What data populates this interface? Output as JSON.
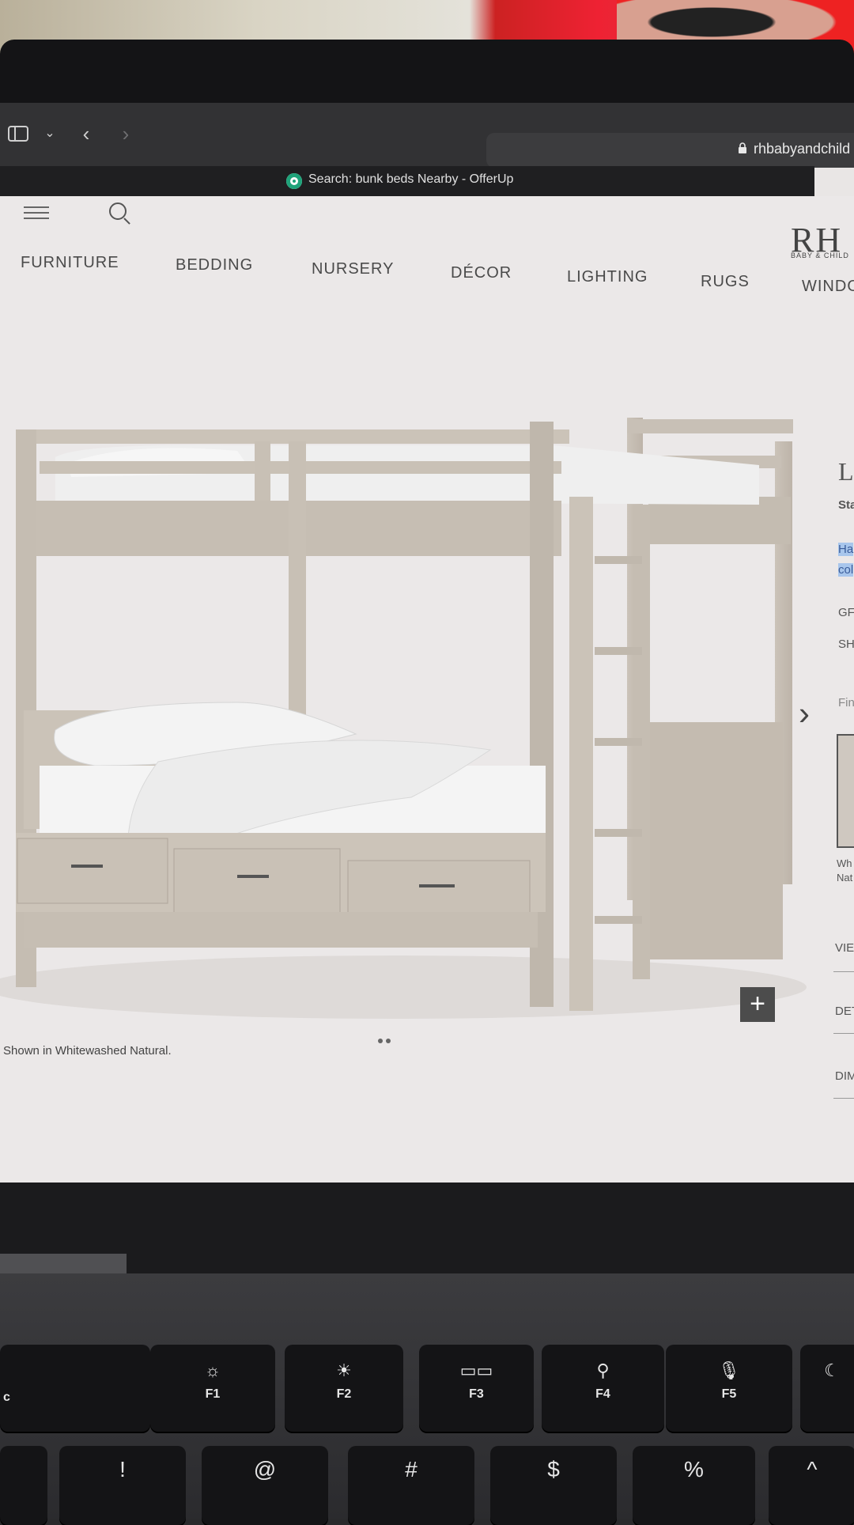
{
  "browser": {
    "url": "rhbabyandchild",
    "tab_title": "Search: bunk beds Nearby - OfferUp"
  },
  "site": {
    "logo": "RH",
    "logo_sub": "BABY & CHILD",
    "nav": [
      "FURNITURE",
      "BEDDING",
      "NURSERY",
      "DÉCOR",
      "LIGHTING",
      "RUGS",
      "WINDO"
    ]
  },
  "product": {
    "caption": "Shown in Whitewashed Natural.",
    "title_fragment": "L",
    "sub_fragment": "Sta",
    "highlight_fragment_1": "Ha",
    "highlight_fragment_2": "col",
    "gr_label": "GF",
    "sh_label": "SH",
    "finish_label": "Fin",
    "swatch_name_1": "Wh",
    "swatch_name_2": "Nat",
    "view_label": "VIE",
    "details_label": "DET",
    "dimensions_label": "DIM",
    "plus_label": "+",
    "next_label": "›"
  },
  "keyboard": {
    "fn_keys": [
      {
        "icon": "☼",
        "label": "F1"
      },
      {
        "icon": "☀",
        "label": "F2"
      },
      {
        "icon": "▭▭",
        "label": "F3"
      },
      {
        "icon": "⚲",
        "label": "F4"
      },
      {
        "icon": "🎙",
        "label": "F5"
      }
    ],
    "number_keys": [
      "!",
      "@",
      "#",
      "$",
      "%",
      "^"
    ]
  }
}
